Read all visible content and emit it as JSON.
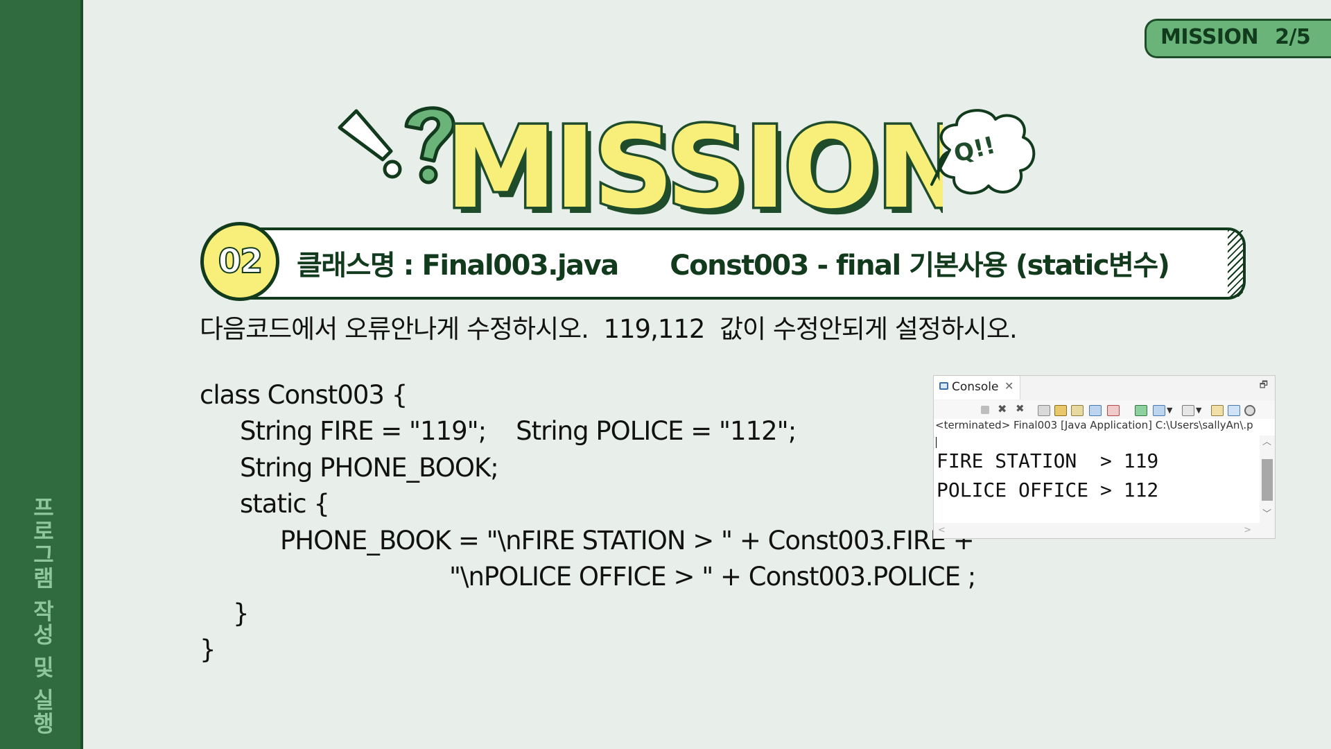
{
  "sidebar": {
    "vertical_title": "프로그램 작성 및 실행"
  },
  "badge": {
    "text": "MISSION  2/5"
  },
  "hero": {
    "title": "MISSION",
    "cloud_text": "Q!!"
  },
  "banner": {
    "number": "02",
    "text": "클래스명 : Final003.java      Const003 - final 기본사용 (static변수)"
  },
  "instruction": "다음코드에서 오류안나게 수정하시오.  119,112  값이 수정안되게 설정하시오.",
  "code": {
    "lines": [
      "class Const003 {",
      "String FIRE = \"119\";    String POLICE = \"112\";",
      "String PHONE_BOOK;",
      "static {",
      "PHONE_BOOK = \"\\nFIRE STATION > \" + Const003.FIRE +",
      "\"\\nPOLICE OFFICE > \" + Const003.POLICE ;",
      "}",
      "}"
    ]
  },
  "console": {
    "tab_label": "Console",
    "status": "<terminated> Final003 [Java Application] C:\\Users\\sallyAn\\.p",
    "output_lines": [
      "FIRE STATION  > 119",
      "POLICE OFFICE > 112"
    ]
  },
  "colors": {
    "sidebar": "#2f6b3e",
    "background": "#e8efea",
    "accent_yellow": "#f7ef7a",
    "accent_green": "#6ab47a",
    "dark_green": "#123a1c"
  }
}
